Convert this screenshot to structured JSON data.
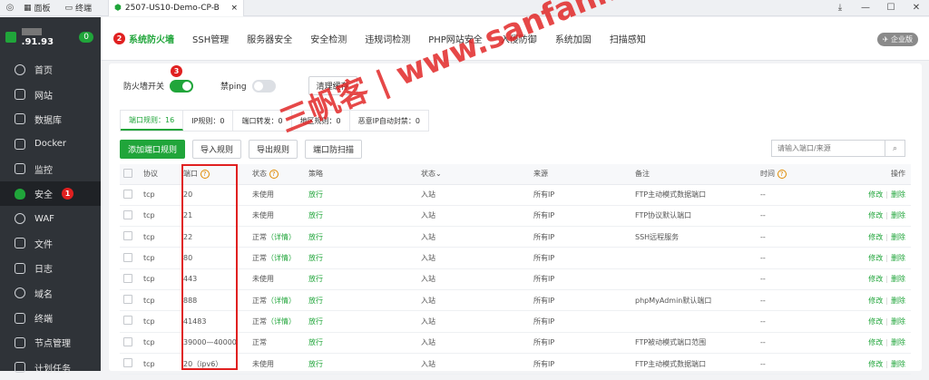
{
  "titlebar": {
    "panel": "面板",
    "terminal": "终端",
    "tab_title": "2507-US10-Demo-CP-B",
    "tab_close": "×",
    "download": "⤓",
    "minimize": "—",
    "maximize": "☐",
    "close": "✕"
  },
  "sidebar": {
    "ip_suffix": ".91.93",
    "badge": "0",
    "items": [
      {
        "label": "首页"
      },
      {
        "label": "网站"
      },
      {
        "label": "数据库"
      },
      {
        "label": "Docker"
      },
      {
        "label": "监控"
      },
      {
        "label": "安全"
      },
      {
        "label": "WAF"
      },
      {
        "label": "文件"
      },
      {
        "label": "日志"
      },
      {
        "label": "域名"
      },
      {
        "label": "终端"
      },
      {
        "label": "节点管理"
      },
      {
        "label": "计划任务"
      }
    ]
  },
  "markers": {
    "m1": "1",
    "m2": "2",
    "m3": "3"
  },
  "topnav": {
    "items": [
      "系统防火墙",
      "SSH管理",
      "服务器安全",
      "安全检测",
      "违规词检测",
      "PHP网站安全",
      "入侵防御",
      "系统加固",
      "扫描感知"
    ],
    "enterprise": "企业版"
  },
  "toolbar": {
    "firewall_label": "防火墙开关",
    "ping_label": "禁ping",
    "clear_cache": "清理缓存"
  },
  "tabs": [
    "端口规则：16",
    "IP规则：0",
    "端口转发：0",
    "地区规则：0",
    "恶意IP自动封禁：0"
  ],
  "actions": {
    "add": "添加端口规则",
    "import": "导入规则",
    "export": "导出规则",
    "scan": "端口防扫描",
    "search_placeholder": "请输入端口/来源"
  },
  "table": {
    "headers": {
      "protocol": "协议",
      "port": "端口",
      "status": "状态",
      "policy": "策略",
      "direction": "状态",
      "source": "来源",
      "remark": "备注",
      "time": "时间",
      "ops": "操作"
    },
    "rows": [
      {
        "protocol": "tcp",
        "port": "20",
        "status": "未使用",
        "detail": "",
        "policy": "放行",
        "direction": "入站",
        "source": "所有IP",
        "remark": "FTP主动模式数据端口",
        "time": "--",
        "edit": "修改",
        "del": "删除"
      },
      {
        "protocol": "tcp",
        "port": "21",
        "status": "未使用",
        "detail": "",
        "policy": "放行",
        "direction": "入站",
        "source": "所有IP",
        "remark": "FTP协议默认端口",
        "time": "--",
        "edit": "修改",
        "del": "删除"
      },
      {
        "protocol": "tcp",
        "port": "22",
        "status": "正常",
        "detail": "（详情）",
        "policy": "放行",
        "direction": "入站",
        "source": "所有IP",
        "remark": "SSH远程服务",
        "time": "--",
        "edit": "修改",
        "del": "删除"
      },
      {
        "protocol": "tcp",
        "port": "80",
        "status": "正常",
        "detail": "（详情）",
        "policy": "放行",
        "direction": "入站",
        "source": "所有IP",
        "remark": "",
        "time": "--",
        "edit": "修改",
        "del": "删除"
      },
      {
        "protocol": "tcp",
        "port": "443",
        "status": "未使用",
        "detail": "",
        "policy": "放行",
        "direction": "入站",
        "source": "所有IP",
        "remark": "",
        "time": "--",
        "edit": "修改",
        "del": "删除"
      },
      {
        "protocol": "tcp",
        "port": "888",
        "status": "正常",
        "detail": "（详情）",
        "policy": "放行",
        "direction": "入站",
        "source": "所有IP",
        "remark": "phpMyAdmin默认端口",
        "time": "--",
        "edit": "修改",
        "del": "删除"
      },
      {
        "protocol": "tcp",
        "port": "41483",
        "status": "正常",
        "detail": "（详情）",
        "policy": "放行",
        "direction": "入站",
        "source": "所有IP",
        "remark": "",
        "time": "--",
        "edit": "修改",
        "del": "删除"
      },
      {
        "protocol": "tcp",
        "port": "39000—40000",
        "status": "正常",
        "detail": "",
        "policy": "放行",
        "direction": "入站",
        "source": "所有IP",
        "remark": "FTP被动模式端口范围",
        "time": "--",
        "edit": "修改",
        "del": "删除"
      },
      {
        "protocol": "tcp",
        "port": "20（ipv6）",
        "status": "未使用",
        "detail": "",
        "policy": "放行",
        "direction": "入站",
        "source": "所有IP",
        "remark": "FTP主动模式数据端口",
        "time": "--",
        "edit": "修改",
        "del": "删除"
      }
    ]
  },
  "watermark": "三帆客 | www.sanfanke.com",
  "colors": {
    "accent": "#20a53a",
    "sidebar": "#2f3338",
    "marker": "#e02020"
  }
}
